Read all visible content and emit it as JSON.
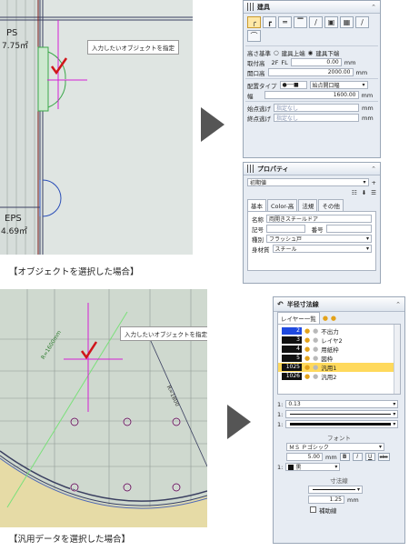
{
  "top": {
    "caption": "【オブジェクトを選択した場合】",
    "canvas": {
      "room1_name": "PS",
      "room1_area": "7.75㎡",
      "room2_name": "EPS",
      "room2_area": "4.69㎡",
      "tooltip": "入力したいオブジェクトを指定"
    },
    "panel": {
      "fixture_header": "建具",
      "height_basis_label": "高さ基準",
      "height_basis_options": [
        "建具上端",
        "建具下端"
      ],
      "install_height_label": "取付高",
      "floor_level": "2F",
      "fl_label": "FL",
      "install_height_value": "0.00",
      "unit_mm": "mm",
      "opening_height_label": "開口高",
      "opening_height_value": "2000.00",
      "layout_type_label": "配置タイプ",
      "layout_type_value": "始点開口幅",
      "width_label": "幅",
      "width_value": "1600.00",
      "start_escape_label": "始点逃げ",
      "end_escape_label": "終点逃げ",
      "unspecified": "指定なし",
      "property_header": "プロパティ",
      "initial_value": "初期値",
      "tabs": [
        "基本",
        "Color-高",
        "法規",
        "その他"
      ],
      "name_label": "名称",
      "name_value": "両開きスチールドア",
      "symbol_label": "記号",
      "number_label": "番号",
      "kind_label": "種別",
      "kind_value": "フラッシュ戸",
      "material_label": "身材質",
      "material_value": "スチール"
    }
  },
  "bottom": {
    "caption": "【汎用データを選択した場合】",
    "canvas": {
      "tooltip": "入力したいオブジェクトを指定",
      "dim1": "R=1600mm",
      "dim2": "R=1800"
    },
    "panel": {
      "header": "半径寸法線",
      "layer_list_label": "レイヤー一覧",
      "layers": [
        {
          "num": "2",
          "name": "不出力"
        },
        {
          "num": "3",
          "name": "レイヤ2"
        },
        {
          "num": "4",
          "name": "用紙枠"
        },
        {
          "num": "5",
          "name": "図枠"
        },
        {
          "num": "1025",
          "name": "汎用1"
        },
        {
          "num": "1026",
          "name": "汎用2"
        }
      ],
      "line_width": "0.13",
      "line_prefix": "1:",
      "font_section": "フォント",
      "font_name": "ＭＳ Ｐゴシック",
      "font_size": "5.00",
      "unit_mm": "mm",
      "bold_label": "B",
      "italic_label": "I",
      "underline_label": "U",
      "strike_label": "abc",
      "color_prefix": "1:",
      "color_name": "黒",
      "dim_section": "寸法線",
      "dim_size": "1.25",
      "aux_line_label": "補助線"
    }
  }
}
